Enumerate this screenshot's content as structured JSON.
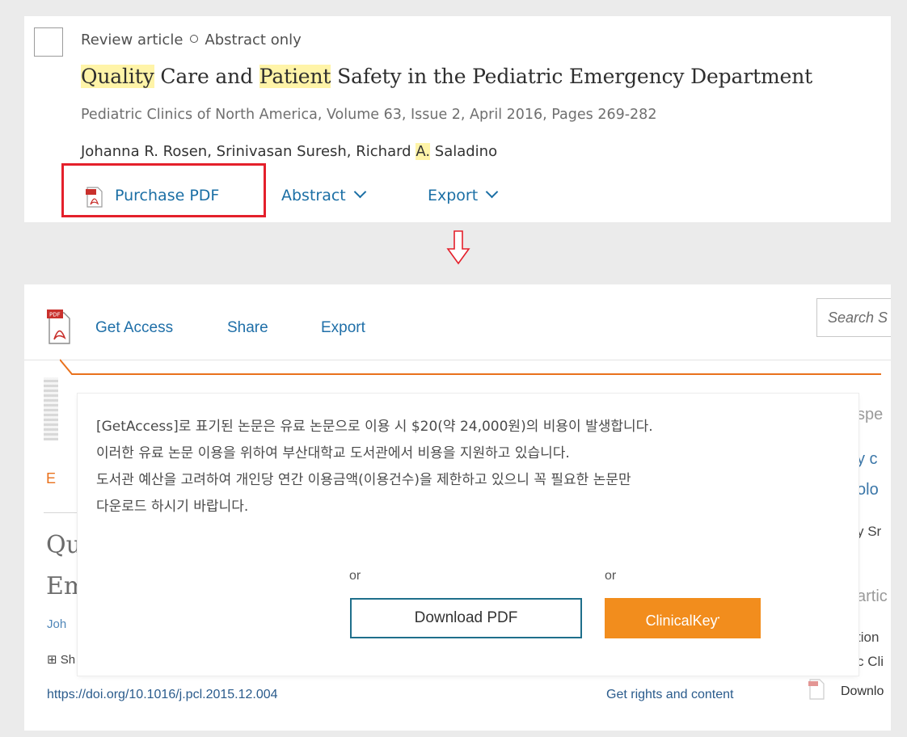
{
  "card": {
    "meta_type": "Review article",
    "meta_access": "Abstract only",
    "title_parts": [
      "Quality",
      " Care and ",
      "Patient",
      " Safety in the Pediatric Emergency Department"
    ],
    "journal": "Pediatric Clinics of North America, Volume 63, Issue 2, April 2016, Pages 269-282",
    "authors_before": "Johanna R. Rosen, Srinivasan Suresh, Richard ",
    "authors_highlight": "A.",
    "authors_after": " Saladino",
    "links": {
      "purchase": "Purchase PDF",
      "abstract": "Abstract",
      "export": "Export"
    }
  },
  "panel": {
    "toolbar": {
      "get_access": "Get Access",
      "share": "Share",
      "export": "Export",
      "search_placeholder": "Search S"
    },
    "background": {
      "title_start_1": "Qu",
      "title_start_2": "Em",
      "authors_start": "Joh",
      "expand_start": "⊞ Sh",
      "logo_letter": "E",
      "doi": "https://doi.org/10.1016/j.pcl.2015.12.004",
      "rights": "Get rights and content",
      "download": "Downlo",
      "right_edge": [
        "spe",
        "y c",
        "olo",
        "y Sr",
        "artic",
        "tion",
        "c Cli"
      ]
    },
    "modal": {
      "notice_lines": [
        "[GetAccess]로 표기된 논문은 유료 논문으로 이용 시 $20(약 24,000원)의 비용이 발생합니다.",
        "이러한 유료 논문 이용을 위하여 부산대학교 도서관에서 비용을 지원하고 있습니다.",
        "도서관 예산을 고려하여 개인당 연간 이용금액(이용건수)을 제한하고 있으니 꼭 필요한 논문만",
        "다운로드 하시기 바랍니다."
      ],
      "or_left": "or",
      "or_right": "or",
      "download_pdf": "Download PDF",
      "clinicalkey": "ClinicalKey"
    }
  },
  "colors": {
    "highlight": "#fff4a8",
    "link_blue": "#1b6fa5",
    "callout_red": "#e4202b",
    "elsevier_orange": "#e9711c",
    "clinicalkey_orange": "#f28d1d",
    "download_border": "#1f6f8b"
  },
  "icons": [
    "checkbox-icon",
    "pdf-icon",
    "chevron-down-icon",
    "down-arrow-icon"
  ]
}
